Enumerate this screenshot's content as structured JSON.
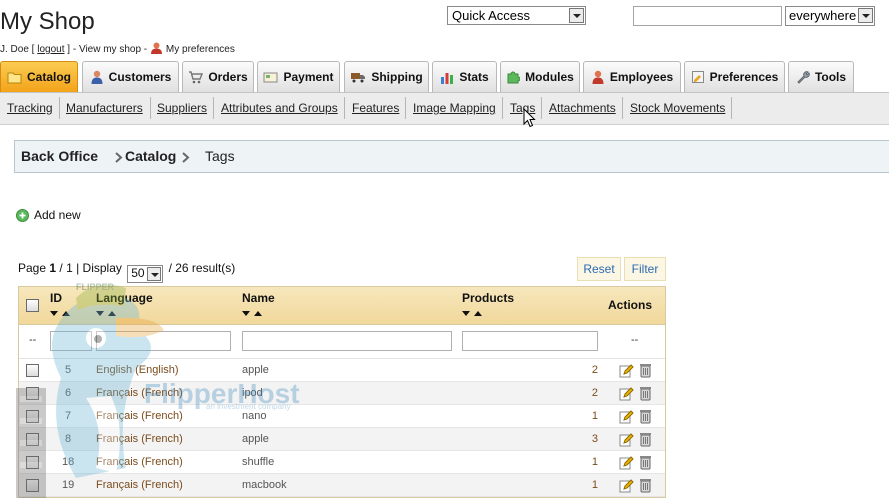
{
  "header": {
    "shop_title": "My Shop",
    "user_name": "J. Doe",
    "logout": "logout",
    "view_shop": "View my shop",
    "preferences": "My preferences",
    "quick_access": "Quick Access",
    "search_value": "",
    "search_scope": "everywhere"
  },
  "tabs": [
    {
      "label": "Catalog",
      "icon": "folder-icon",
      "active": true
    },
    {
      "label": "Customers",
      "icon": "customer-icon"
    },
    {
      "label": "Orders",
      "icon": "cart-icon"
    },
    {
      "label": "Payment",
      "icon": "payment-icon"
    },
    {
      "label": "Shipping",
      "icon": "truck-icon"
    },
    {
      "label": "Stats",
      "icon": "chart-icon"
    },
    {
      "label": "Modules",
      "icon": "puzzle-icon"
    },
    {
      "label": "Employees",
      "icon": "employee-icon"
    },
    {
      "label": "Preferences",
      "icon": "preferences-icon"
    },
    {
      "label": "Tools",
      "icon": "wrench-icon"
    }
  ],
  "subnav": [
    "Tracking",
    "Manufacturers",
    "Suppliers",
    "Attributes and Groups",
    "Features",
    "Image Mapping",
    "Tags",
    "Attachments",
    "Stock Movements"
  ],
  "breadcrumb": [
    "Back Office",
    "Catalog",
    "Tags"
  ],
  "add_new": "Add new",
  "pagination": {
    "page_label": "Page",
    "page": "1",
    "of": "/ 1 | Display",
    "display": "50",
    "results": "/ 26 result(s)"
  },
  "buttons": {
    "reset": "Reset",
    "filter": "Filter"
  },
  "table": {
    "columns": {
      "id": "ID",
      "language": "Language",
      "name": "Name",
      "products": "Products",
      "actions": "Actions"
    },
    "filter_dash": "--",
    "rows": [
      {
        "id": "5",
        "language": "English (English)",
        "name": "apple",
        "products": "2"
      },
      {
        "id": "6",
        "language": "Français (French)",
        "name": "ipod",
        "products": "2"
      },
      {
        "id": "7",
        "language": "Français (French)",
        "name": "nano",
        "products": "1"
      },
      {
        "id": "8",
        "language": "Français (French)",
        "name": "apple",
        "products": "3"
      },
      {
        "id": "18",
        "language": "Français (French)",
        "name": "shuffle",
        "products": "1"
      },
      {
        "id": "19",
        "language": "Français (French)",
        "name": "macbook",
        "products": "1"
      }
    ]
  },
  "watermark": {
    "brand": "FlipperHost",
    "tagline": "an investment company",
    "mascot_label": "FLIPPER"
  },
  "colors": {
    "active_tab": "#f3a31a",
    "link_brown": "#7a4b1c",
    "button_text": "#2b6bb0"
  }
}
